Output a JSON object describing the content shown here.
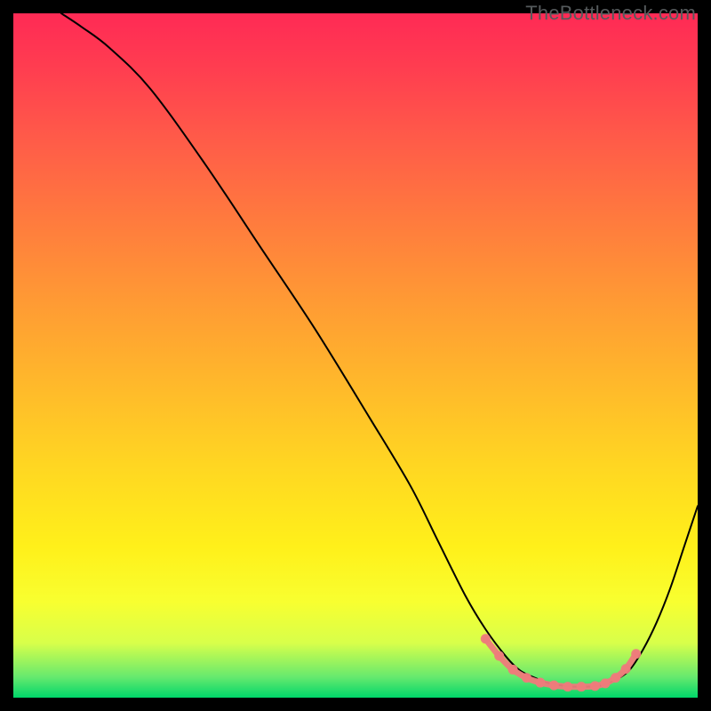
{
  "watermark": "TheBottleneck.com",
  "colors": {
    "curve": "#000000",
    "markers": "#ee7b7b",
    "frame": "#000000"
  },
  "chart_data": {
    "type": "line",
    "title": "",
    "xlabel": "",
    "ylabel": "",
    "xlim": [
      0,
      100
    ],
    "ylim": [
      0,
      100
    ],
    "grid": false,
    "legend": false,
    "series": [
      {
        "name": "bottleneck-curve",
        "x": [
          7,
          10,
          14,
          20,
          28,
          36,
          44,
          52,
          58,
          62,
          66,
          69,
          72,
          74,
          76,
          78,
          80,
          82,
          84,
          86,
          88,
          90,
          92,
          94,
          96,
          98,
          100
        ],
        "y": [
          100,
          98,
          95,
          89,
          78,
          66,
          54,
          41,
          31,
          23,
          15,
          10,
          6,
          4,
          3,
          2.2,
          1.8,
          1.6,
          1.6,
          1.8,
          2.6,
          4,
          7,
          11,
          16,
          22,
          28
        ]
      }
    ],
    "markers": {
      "name": "highlighted-range",
      "x": [
        69,
        71,
        73,
        75,
        77,
        79,
        81,
        83,
        85,
        86.5,
        88,
        89.5,
        91
      ],
      "y": [
        8.6,
        6.1,
        4.1,
        2.9,
        2.2,
        1.8,
        1.6,
        1.6,
        1.7,
        2.1,
        2.9,
        4.2,
        6.4
      ]
    },
    "annotations": [
      {
        "text": "TheBottleneck.com",
        "position": "top-right"
      }
    ],
    "background_gradient": {
      "orientation": "vertical",
      "stops": [
        {
          "offset": 0.0,
          "color": "#ff2a55"
        },
        {
          "offset": 0.3,
          "color": "#ff7a3e"
        },
        {
          "offset": 0.6,
          "color": "#ffd622"
        },
        {
          "offset": 0.86,
          "color": "#f8ff30"
        },
        {
          "offset": 0.97,
          "color": "#66e96e"
        },
        {
          "offset": 1.0,
          "color": "#00d66a"
        }
      ]
    }
  }
}
